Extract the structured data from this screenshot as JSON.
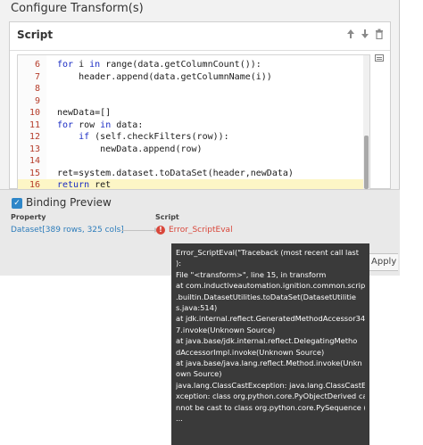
{
  "dialog": {
    "title": "Configure Transform(s)"
  },
  "script_panel": {
    "title": "Script",
    "icons": [
      "arrow-up-icon",
      "arrow-down-icon",
      "trash-icon"
    ],
    "lines": [
      {
        "num": "6",
        "text": "for i in range(data.getColumnCount()):"
      },
      {
        "num": "7",
        "text": "    header.append(data.getColumnName(i))"
      },
      {
        "num": "8",
        "text": ""
      },
      {
        "num": "9",
        "text": ""
      },
      {
        "num": "10",
        "text": "newData=[]"
      },
      {
        "num": "11",
        "text": "for row in data:"
      },
      {
        "num": "12",
        "text": "    if (self.checkFilters(row)):"
      },
      {
        "num": "13",
        "text": "        newData.append(row)"
      },
      {
        "num": "14",
        "text": ""
      },
      {
        "num": "15",
        "text": "ret=system.dataset.toDataSet(header,newData)"
      },
      {
        "num": "16",
        "text": "return ret"
      }
    ]
  },
  "binding_preview": {
    "title": "Binding Preview",
    "checked": true,
    "property_label": "Property",
    "property_value": "Dataset[389 rows, 325 cols]",
    "script_label": "Script",
    "script_value": "Error_ScriptEval"
  },
  "buttons": {
    "apply": "Apply"
  },
  "tooltip": {
    "lines": [
      "Error_ScriptEval(\"Traceback (most recent call last",
      "):",
      "File \"<transform>\", line 15, in transform",
      "at com.inductiveautomation.ignition.common.script",
      ".builtin.DatasetUtilities.toDataSet(DatasetUtilitie",
      "s.java:514)",
      "at jdk.internal.reflect.GeneratedMethodAccessor34",
      "7.invoke(Unknown Source)",
      "at java.base/jdk.internal.reflect.DelegatingMetho",
      "dAccessorImpl.invoke(Unknown Source)",
      "at java.base/java.lang.reflect.Method.invoke(Unkn",
      "own Source)",
      "java.lang.ClassCastException: java.lang.ClassCastE",
      "xception: class org.python.core.PyObjectDerived ca",
      "nnot be cast to class org.python.core.PySequence (",
      "..."
    ]
  }
}
